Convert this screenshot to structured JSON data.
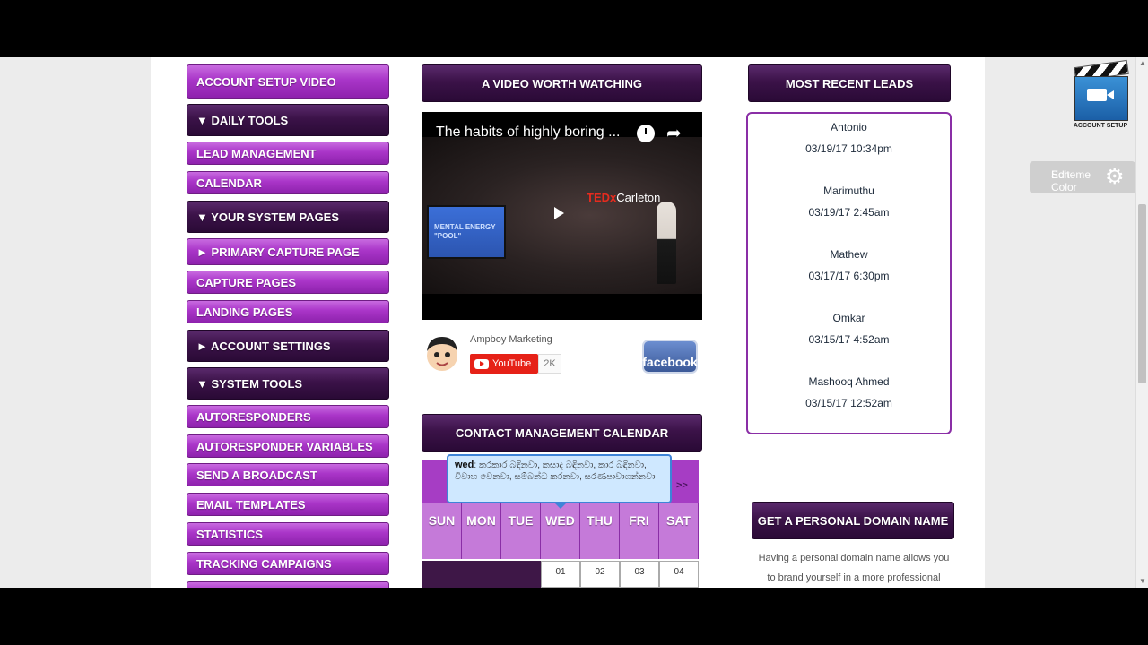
{
  "nav": {
    "items": [
      {
        "label": "ACCOUNT SETUP VIDEO",
        "style": "purple"
      },
      {
        "label": "▼ DAILY TOOLS",
        "style": "dark"
      },
      {
        "label": "LEAD MANAGEMENT",
        "style": "purple"
      },
      {
        "label": "CALENDAR",
        "style": "purple"
      },
      {
        "label": "▼ YOUR SYSTEM PAGES",
        "style": "dark"
      },
      {
        "label": "► PRIMARY CAPTURE PAGE",
        "style": "purple"
      },
      {
        "label": "CAPTURE PAGES",
        "style": "purple"
      },
      {
        "label": "LANDING PAGES",
        "style": "purple"
      },
      {
        "label": "► ACCOUNT SETTINGS",
        "style": "dark"
      },
      {
        "label": "▼ SYSTEM TOOLS",
        "style": "dark"
      },
      {
        "label": "AUTORESPONDERS",
        "style": "purple"
      },
      {
        "label": "AUTORESPONDER VARIABLES",
        "style": "purple"
      },
      {
        "label": "SEND A BROADCAST",
        "style": "purple"
      },
      {
        "label": "EMAIL TEMPLATES",
        "style": "purple"
      },
      {
        "label": "STATISTICS",
        "style": "purple"
      },
      {
        "label": "TRACKING CAMPAIGNS",
        "style": "purple"
      }
    ]
  },
  "video_section": {
    "header": "A VIDEO WORTH WATCHING",
    "video_title": "The habits of highly boring ...",
    "ted_brand": "TEDx",
    "ted_event": "Carleton",
    "screen_text": "MENTAL ENERGY \"POOL\"",
    "channel_name": "Ampboy Marketing",
    "youtube_label": "YouTube",
    "subscriber_count": "2K",
    "facebook_label": "facebook"
  },
  "calendar": {
    "header": "CONTACT MANAGEMENT CALENDAR",
    "next_label": ">>",
    "days": [
      "SUN",
      "MON",
      "TUE",
      "WED",
      "THU",
      "FRI",
      "SAT"
    ],
    "dates": [
      "01",
      "02",
      "03",
      "04"
    ],
    "tooltip": {
      "day": "wed",
      "text": ": කරකාර බඳිනවා, කසාද බඳිනවා, කාර බඳිනවා, විවාහ වෙනවා, සම්බන්ධ කරනවා, සරණපාවාගන්නවා"
    }
  },
  "leads": {
    "header": "MOST RECENT LEADS",
    "items": [
      {
        "name": "Antonio",
        "time": "03/19/17 10:34pm"
      },
      {
        "name": "Marimuthu",
        "time": "03/19/17 2:45am"
      },
      {
        "name": "Mathew",
        "time": "03/17/17 6:30pm"
      },
      {
        "name": "Omkar",
        "time": "03/15/17 4:52am"
      },
      {
        "name": "Mashooq Ahmed",
        "time": "03/15/17 12:52am"
      }
    ]
  },
  "domain": {
    "header": "GET A PERSONAL DOMAIN NAME",
    "line1": "Having a personal domain name allows you",
    "line2": "to brand yourself in a more professional"
  },
  "widgets": {
    "account_setup_label": "ACCOUNT SETUP",
    "edit_color_line1": "Edit Color",
    "edit_color_line2": "Scheme"
  },
  "colors": {
    "nav_purple": "#a935c8",
    "header_dark": "#3b1248",
    "calendar_purple": "#a63dc4",
    "tooltip_bg": "#cfe8ff"
  }
}
